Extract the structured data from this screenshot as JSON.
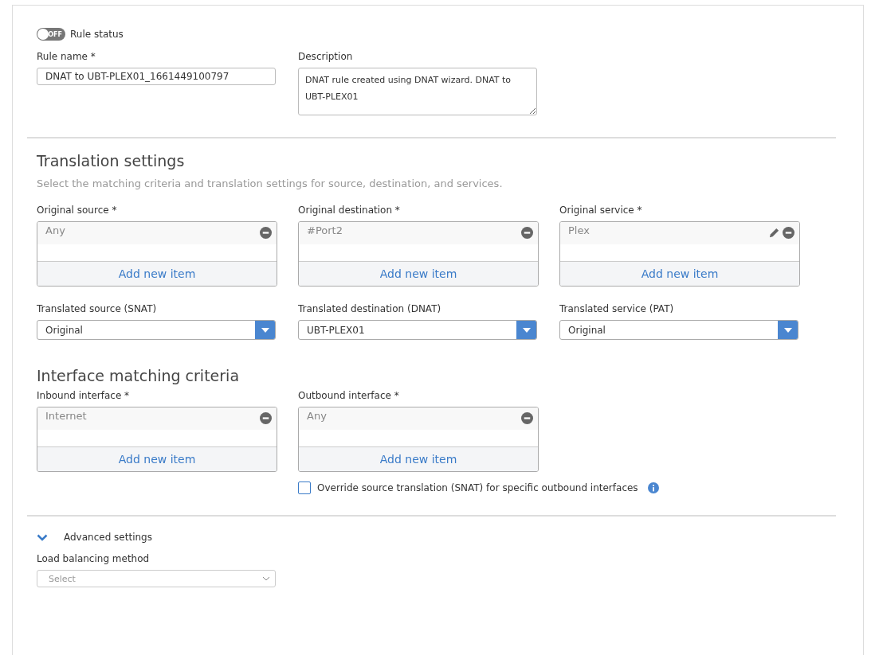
{
  "rule_status": {
    "label": "Rule status",
    "toggle_text": "OFF",
    "on": false
  },
  "rule_name": {
    "label": "Rule name *",
    "value": "DNAT to UBT-PLEX01_1661449100797"
  },
  "description": {
    "label": "Description",
    "value": "DNAT rule created using DNAT wizard. DNAT to UBT-PLEX01"
  },
  "translation": {
    "title": "Translation settings",
    "subtitle": "Select the matching criteria and translation settings for source, destination, and services.",
    "lists": [
      {
        "label": "Original source *",
        "items": [
          {
            "text": "Any",
            "editable": false
          }
        ],
        "add_label": "Add new item"
      },
      {
        "label": "Original destination *",
        "items": [
          {
            "text": "#Port2",
            "editable": false
          }
        ],
        "add_label": "Add new item"
      },
      {
        "label": "Original service *",
        "items": [
          {
            "text": "Plex",
            "editable": true
          }
        ],
        "add_label": "Add new item"
      }
    ],
    "selects": [
      {
        "label": "Translated source (SNAT)",
        "value": "Original"
      },
      {
        "label": "Translated destination (DNAT)",
        "value": "UBT-PLEX01"
      },
      {
        "label": "Translated service (PAT)",
        "value": "Original"
      }
    ]
  },
  "interface": {
    "title": "Interface matching criteria",
    "lists": [
      {
        "label": "Inbound interface *",
        "items": [
          {
            "text": "Internet",
            "editable": false
          }
        ],
        "add_label": "Add new item"
      },
      {
        "label": "Outbound interface *",
        "items": [
          {
            "text": "Any",
            "editable": false
          }
        ],
        "add_label": "Add new item"
      }
    ],
    "override": {
      "label": "Override source translation (SNAT) for specific outbound interfaces",
      "checked": false
    }
  },
  "advanced": {
    "label": "Advanced settings",
    "expanded": true,
    "load_balancing": {
      "label": "Load balancing method",
      "placeholder": "Select"
    }
  }
}
